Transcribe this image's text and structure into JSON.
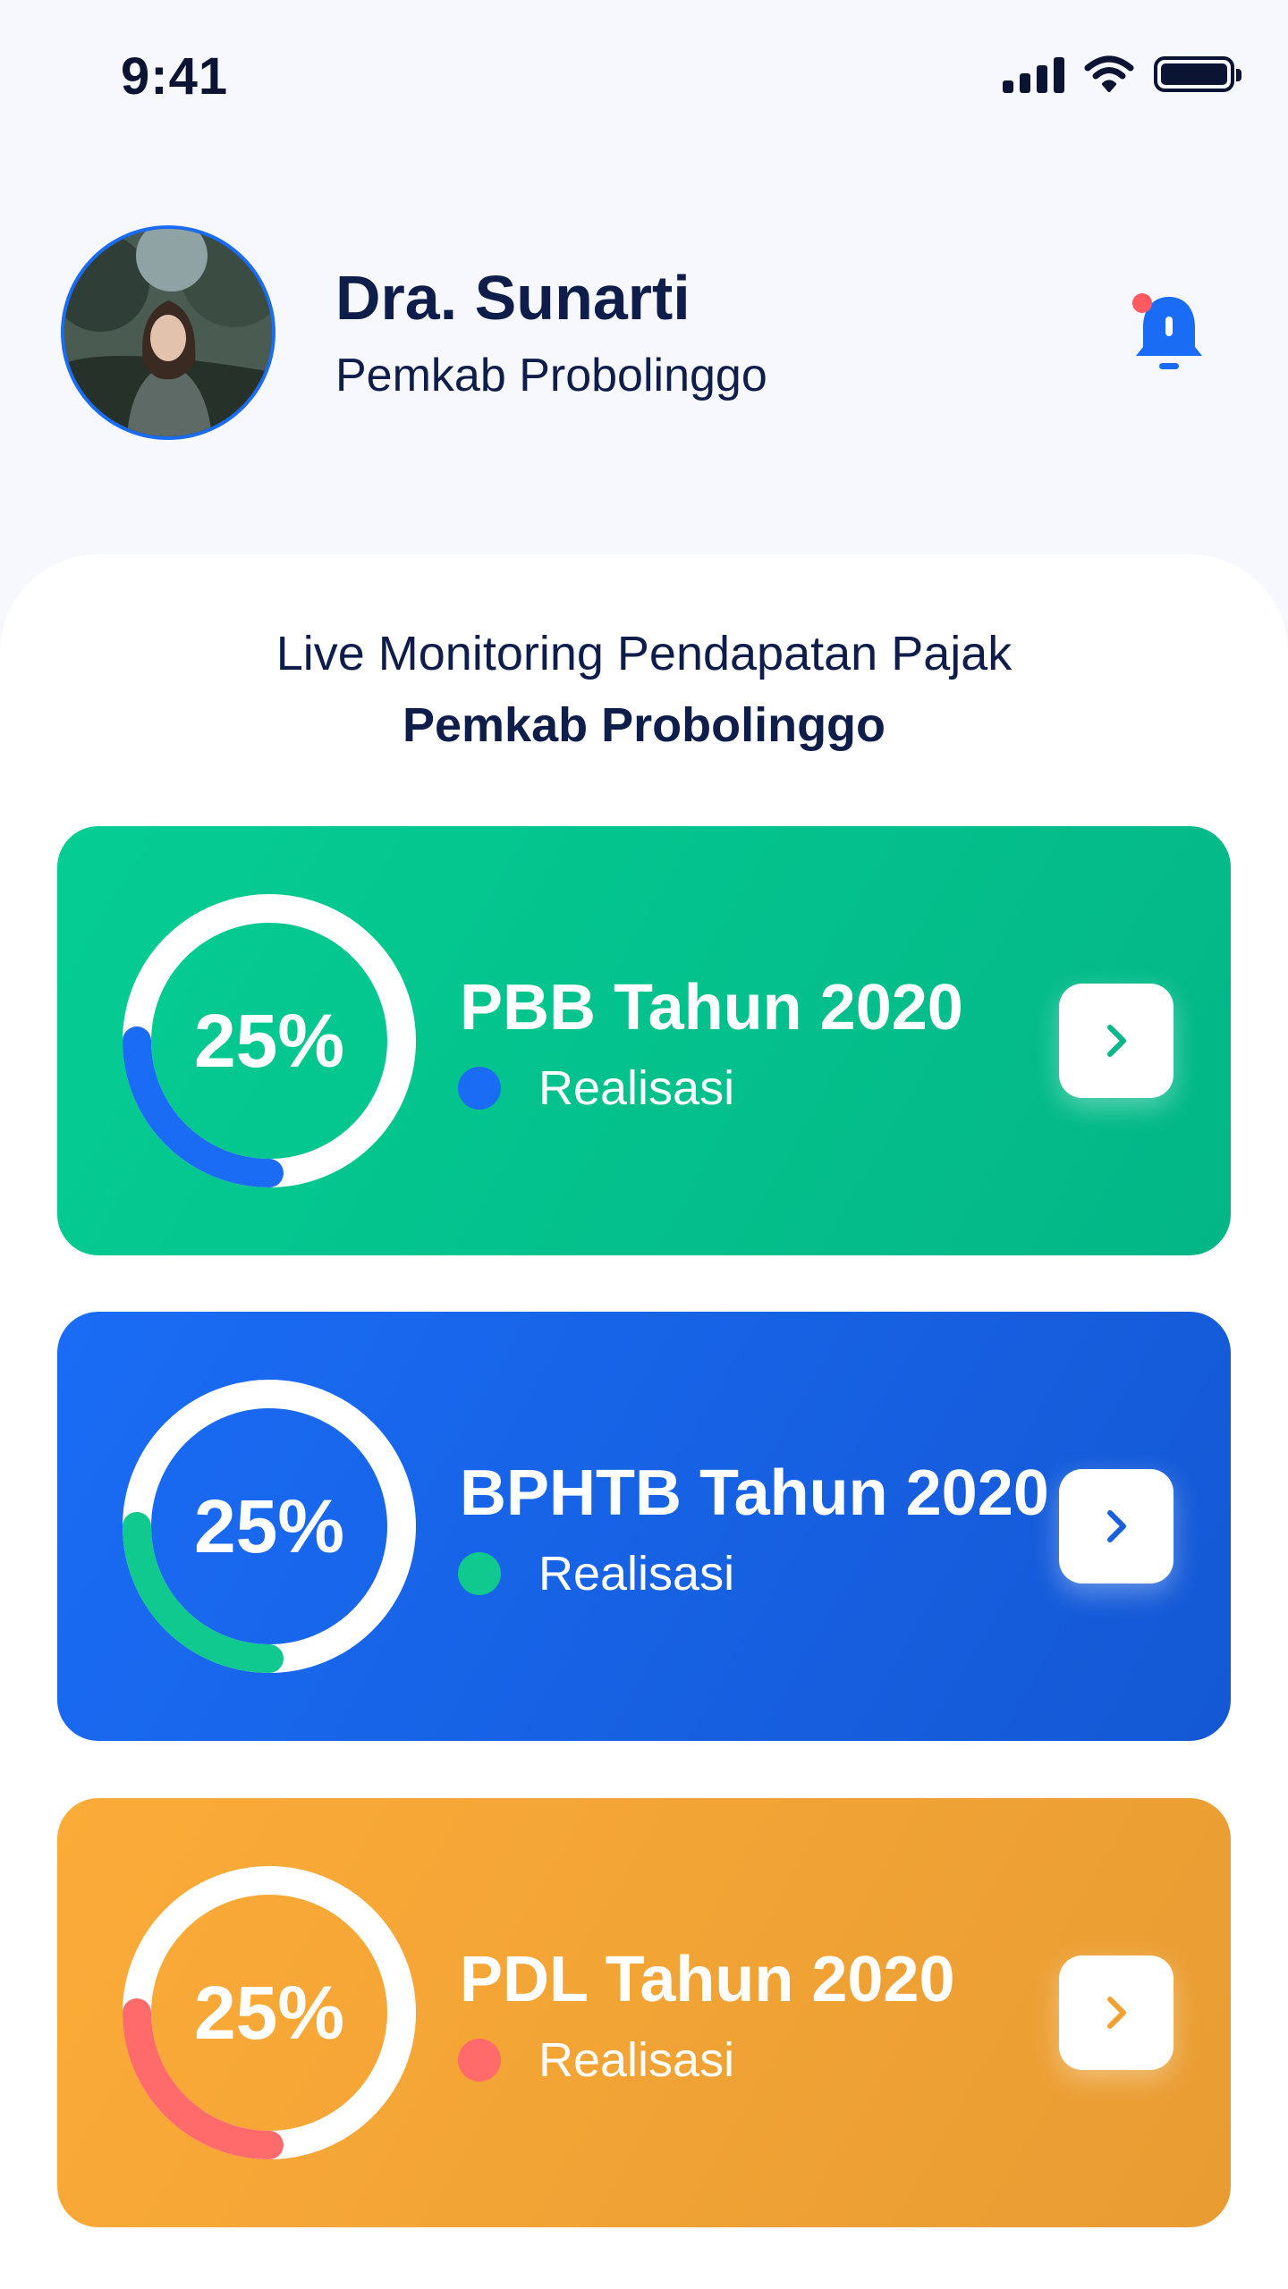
{
  "status_bar": {
    "time": "9:41"
  },
  "profile": {
    "name": "Dra. Sunarti",
    "organization": "Pemkab Probolinggo"
  },
  "sheet": {
    "title": "Live Monitoring Pendapatan Pajak",
    "subtitle": "Pemkab Probolinggo"
  },
  "cards": [
    {
      "title": "PBB Tahun 2020",
      "value_label": "25%",
      "progress": 0.25,
      "legend": "Realisasi",
      "progress_color": "#1a6cf5",
      "arrow_color": "#05b889"
    },
    {
      "title": "BPHTB Tahun 2020",
      "value_label": "25%",
      "progress": 0.25,
      "legend": "Realisasi",
      "progress_color": "#10c98e",
      "arrow_color": "#1a5fd9"
    },
    {
      "title": "PDL Tahun 2020",
      "value_label": "25%",
      "progress": 0.25,
      "legend": "Realisasi",
      "progress_color": "#ff6b6b",
      "arrow_color": "#f0a134"
    }
  ],
  "colors": {
    "accent": "#1a6cf5",
    "notification_dot": "#ff5a5f",
    "text_dark": "#0f1d4a"
  },
  "icons": {
    "notification": "bell-icon",
    "arrow": "chevron-right-icon",
    "battery": "battery-icon",
    "wifi": "wifi-icon",
    "signal": "cellular-signal-icon"
  }
}
